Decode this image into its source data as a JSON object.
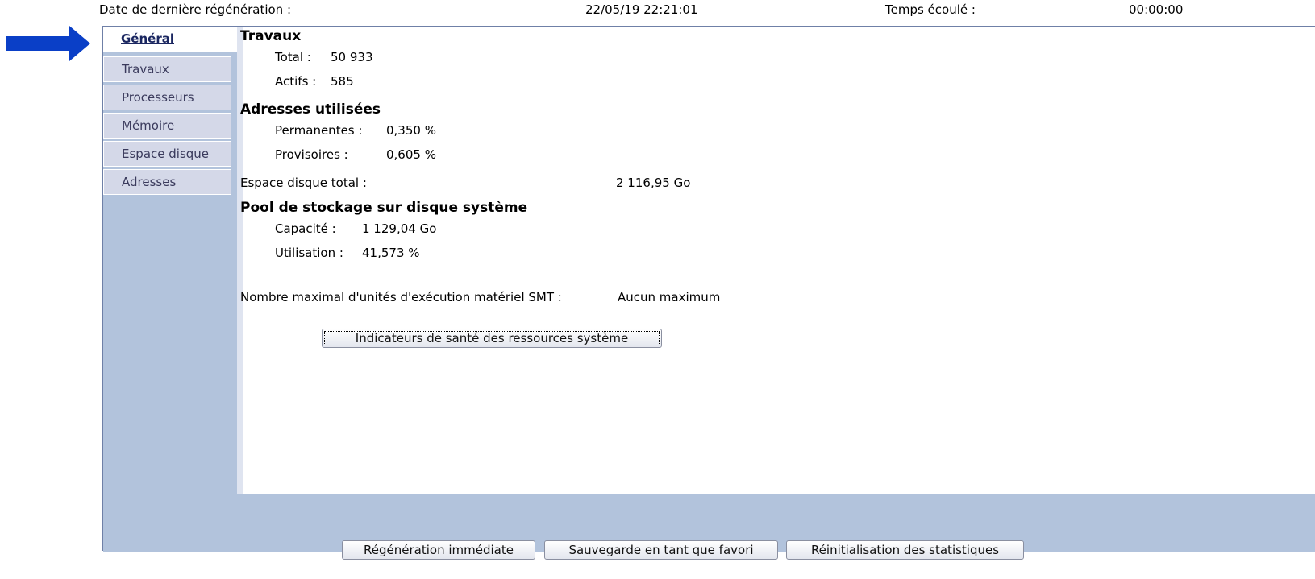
{
  "status": {
    "refresh_label": "Date de dernière régénération :",
    "refresh_value": "22/05/19 22:21:01",
    "elapsed_label": "Temps écoulé :",
    "elapsed_value": "00:00:00"
  },
  "tabs": [
    {
      "label": "Général",
      "active": true
    },
    {
      "label": "Travaux"
    },
    {
      "label": "Processeurs"
    },
    {
      "label": "Mémoire"
    },
    {
      "label": "Espace disque"
    },
    {
      "label": "Adresses"
    }
  ],
  "general": {
    "jobs_heading": "Travaux",
    "total_label": "Total :",
    "total_value": "50 933",
    "active_label": "Actifs :",
    "active_value": "585",
    "addresses_heading": "Adresses utilisées",
    "permanent_label": "Permanentes :",
    "permanent_value": "0,350 %",
    "temporary_label": "Provisoires :",
    "temporary_value": "0,605 %",
    "disk_total_label": "Espace disque total :",
    "disk_total_value": "2 116,95 Go",
    "pool_heading": "Pool de stockage sur disque système",
    "capacity_label": "Capacité :",
    "capacity_value": "1 129,04 Go",
    "usage_label": "Utilisation :",
    "usage_value": "41,573 %",
    "smt_label": "Nombre maximal d'unités d'exécution matériel SMT :",
    "smt_value": "Aucun maximum",
    "health_button": "Indicateurs de santé des ressources système"
  },
  "actions": {
    "refresh_now": "Régénération immédiate",
    "save_favorite": "Sauvegarde en tant que favori",
    "reset_stats": "Réinitialisation des statistiques"
  },
  "colors": {
    "arrow": "#0a3fc7",
    "sidebar": "#b2c3dc"
  }
}
